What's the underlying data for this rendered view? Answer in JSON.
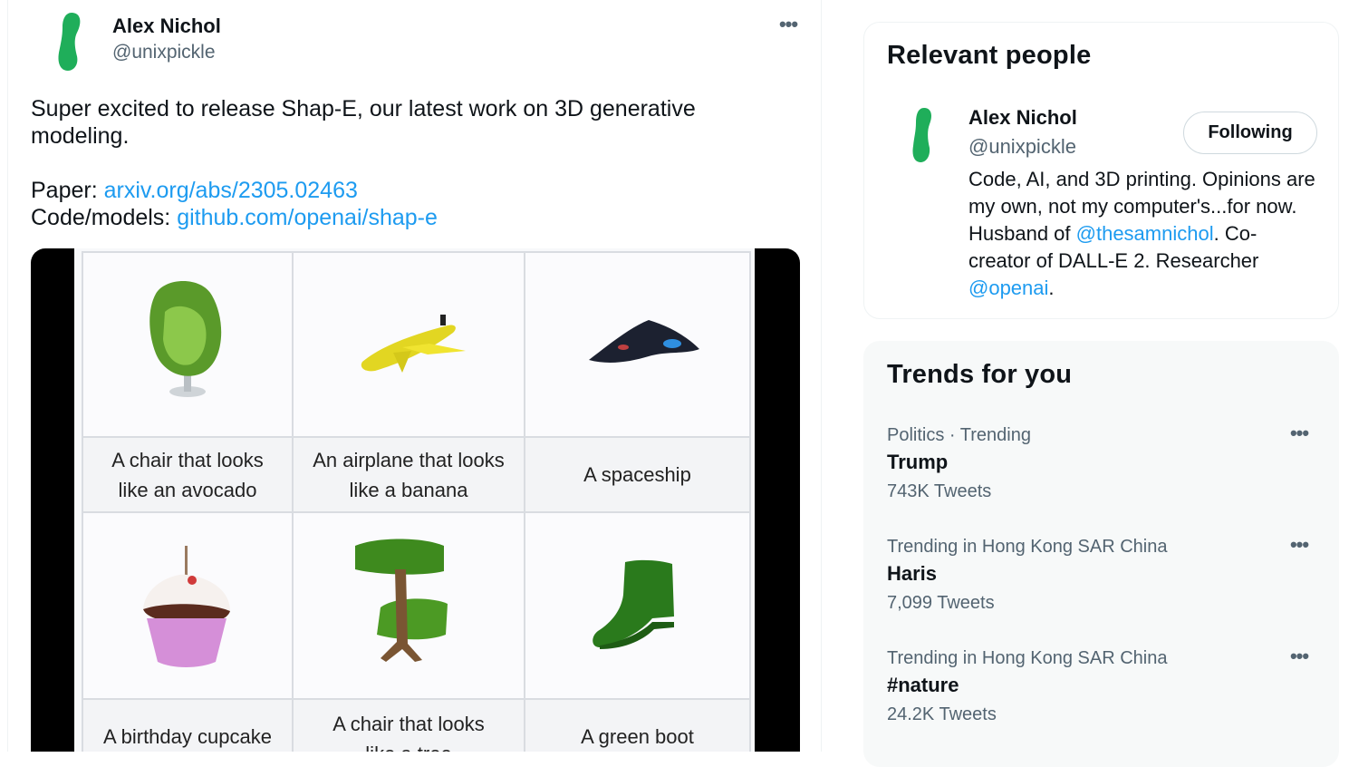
{
  "tweet": {
    "author_name": "Alex Nichol",
    "author_handle": "@unixpickle",
    "more_icon": "•••",
    "text_line1": "Super excited to release Shap-E, our latest work on 3D generative",
    "text_line2": "modeling.",
    "paper_label": "Paper: ",
    "paper_link": "arxiv.org/abs/2305.02463",
    "code_label": "Code/models: ",
    "code_link": "github.com/openai/shap-e",
    "media": {
      "captions": [
        {
          "line1": "A chair that looks",
          "line2": "like an avocado"
        },
        {
          "line1": "An airplane that looks",
          "line2": "like a banana"
        },
        {
          "line1": "A spaceship",
          "line2": ""
        },
        {
          "line1": "A birthday cupcake",
          "line2": ""
        },
        {
          "line1": "A chair that looks",
          "line2": "like a tree"
        },
        {
          "line1": "A green boot",
          "line2": ""
        }
      ]
    }
  },
  "sidebar": {
    "relevant_people": {
      "title": "Relevant people",
      "name": "Alex Nichol",
      "handle": "@unixpickle",
      "follow_button": "Following",
      "bio_part1": "Code, AI, and 3D printing. Opinions are my own, not my computer's...for now. Husband of ",
      "bio_mention1": "@thesamnichol",
      "bio_part2": ". Co-creator of DALL-E 2. Researcher ",
      "bio_mention2": "@openai",
      "bio_part3": "."
    },
    "trends": {
      "title": "Trends for you",
      "more_icon": "•••",
      "items": [
        {
          "meta": "Politics · Trending",
          "name": "Trump",
          "count": "743K Tweets"
        },
        {
          "meta": "Trending in Hong Kong SAR China",
          "name": "Haris",
          "count": "7,099 Tweets"
        },
        {
          "meta": "Trending in Hong Kong SAR China",
          "name": "#nature",
          "count": "24.2K Tweets"
        }
      ]
    }
  },
  "colors": {
    "link": "#1d9bf0",
    "secondary_text": "#536471",
    "avatar_green": "#1fae5a"
  }
}
